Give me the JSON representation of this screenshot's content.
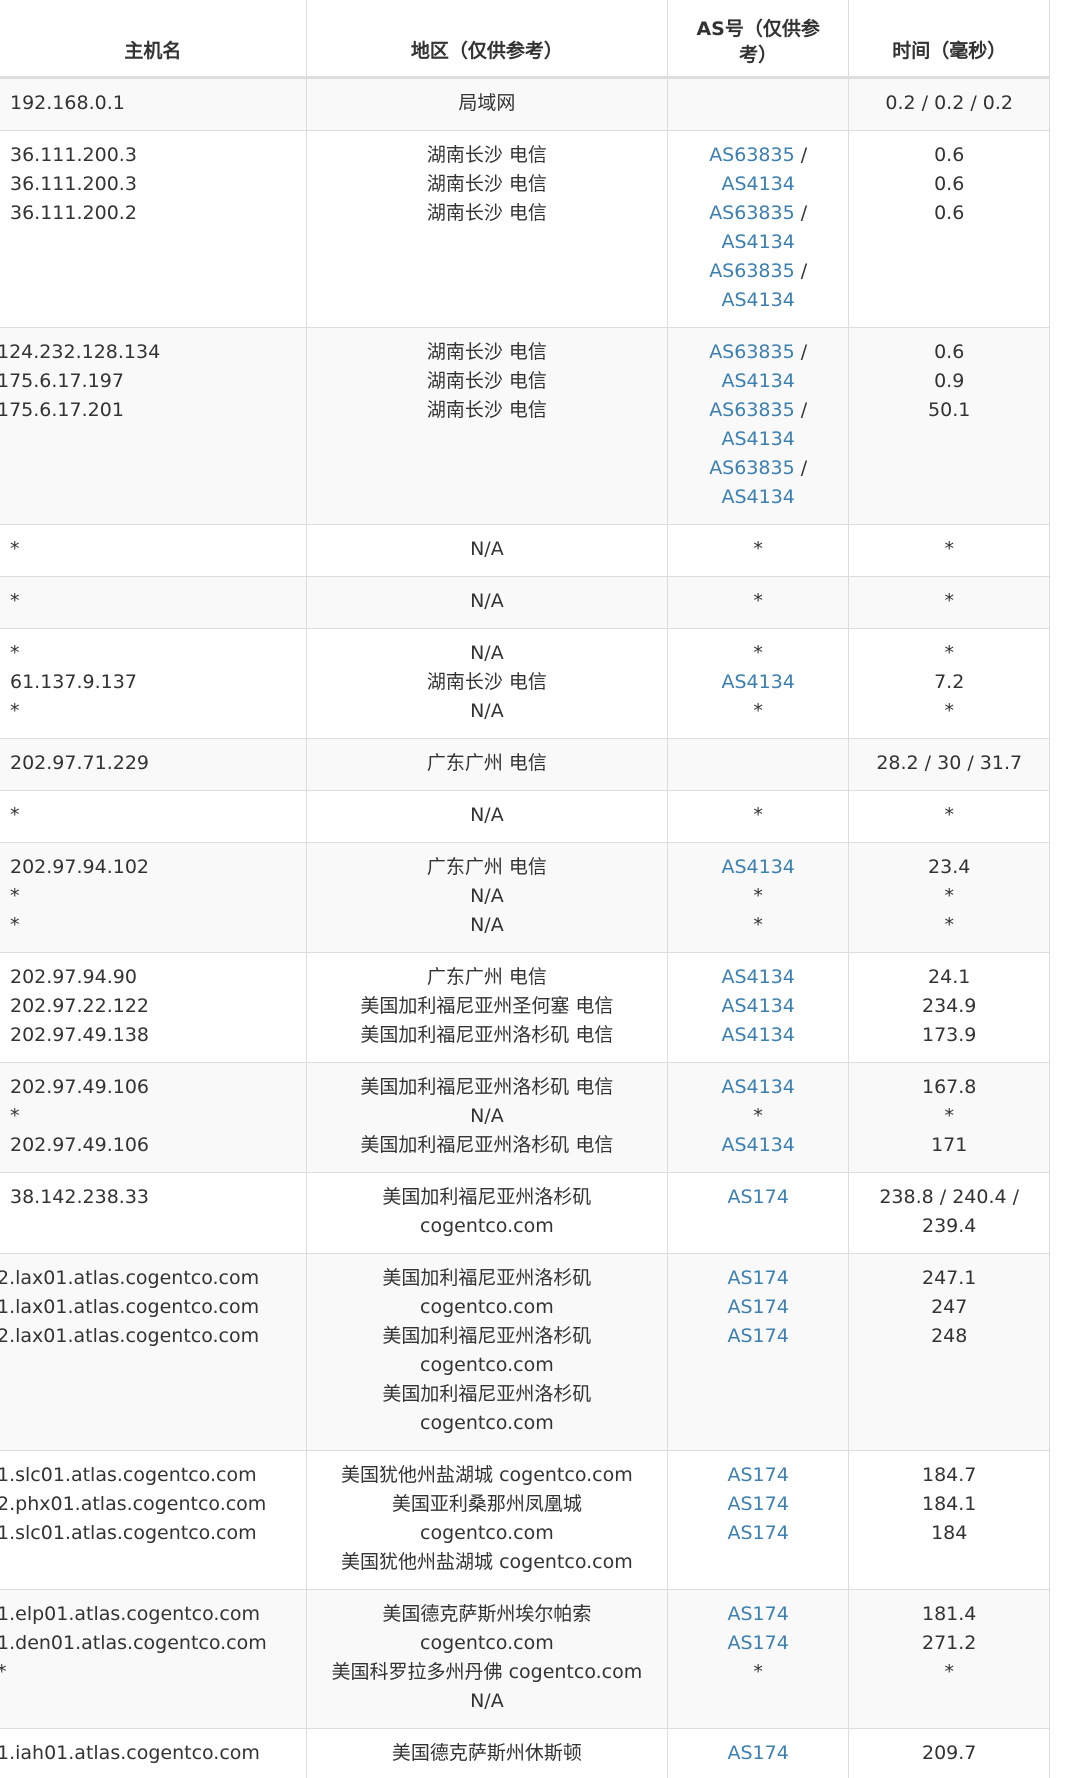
{
  "headers": {
    "host": "主机名",
    "location": "地区（仅供参考）",
    "as_line1": "AS号（仅供参",
    "as_line2": "考）",
    "time": "时间（毫秒）"
  },
  "rows": [
    {
      "hosts": [
        "192.168.0.1"
      ],
      "locations": [
        "局域网"
      ],
      "as": [],
      "times": [
        "0.2 / 0.2 / 0.2"
      ]
    },
    {
      "hosts": [
        "36.111.200.3",
        "36.111.200.3",
        "36.111.200.2"
      ],
      "locations": [
        "湖南长沙 电信",
        "湖南长沙 电信",
        "湖南长沙 电信"
      ],
      "as": [
        [
          "AS63835",
          "AS4134"
        ],
        [
          "AS63835",
          "AS4134"
        ],
        [
          "AS63835",
          "AS4134"
        ]
      ],
      "times": [
        "0.6",
        "0.6",
        "0.6"
      ]
    },
    {
      "hosts": [
        "124.232.128.134",
        "175.6.17.197",
        "175.6.17.201"
      ],
      "locations": [
        "湖南长沙 电信",
        "湖南长沙 电信",
        "湖南长沙 电信"
      ],
      "as": [
        [
          "AS63835",
          "AS4134"
        ],
        [
          "AS63835",
          "AS4134"
        ],
        [
          "AS63835",
          "AS4134"
        ]
      ],
      "times": [
        "0.6",
        "0.9",
        "50.1"
      ]
    },
    {
      "hosts": [
        "*"
      ],
      "locations": [
        "N/A"
      ],
      "as": [
        [
          "*"
        ]
      ],
      "times": [
        "*"
      ]
    },
    {
      "hosts": [
        "*"
      ],
      "locations": [
        "N/A"
      ],
      "as": [
        [
          "*"
        ]
      ],
      "times": [
        "*"
      ]
    },
    {
      "hosts": [
        "*",
        "61.137.9.137",
        "*"
      ],
      "locations": [
        "N/A",
        "湖南长沙 电信",
        "N/A"
      ],
      "as": [
        [
          "*"
        ],
        [
          "AS4134"
        ],
        [
          "*"
        ]
      ],
      "times": [
        "*",
        "7.2",
        "*"
      ]
    },
    {
      "hosts": [
        "202.97.71.229"
      ],
      "locations": [
        "广东广州 电信"
      ],
      "as": [],
      "times": [
        "28.2 / 30 / 31.7"
      ]
    },
    {
      "hosts": [
        "*"
      ],
      "locations": [
        "N/A"
      ],
      "as": [
        [
          "*"
        ]
      ],
      "times": [
        "*"
      ]
    },
    {
      "hosts": [
        "202.97.94.102",
        "*",
        "*"
      ],
      "locations": [
        "广东广州 电信",
        "N/A",
        "N/A"
      ],
      "as": [
        [
          "AS4134"
        ],
        [
          "*"
        ],
        [
          "*"
        ]
      ],
      "times": [
        "23.4",
        "*",
        "*"
      ]
    },
    {
      "hosts": [
        "202.97.94.90",
        "202.97.22.122",
        "202.97.49.138"
      ],
      "locations": [
        "广东广州 电信",
        "美国加利福尼亚州圣何塞 电信",
        "美国加利福尼亚州洛杉矶 电信"
      ],
      "as": [
        [
          "AS4134"
        ],
        [
          "AS4134"
        ],
        [
          "AS4134"
        ]
      ],
      "times": [
        "24.1",
        "234.9",
        "173.9"
      ]
    },
    {
      "hosts": [
        "202.97.49.106",
        "*",
        "202.97.49.106"
      ],
      "locations": [
        "美国加利福尼亚州洛杉矶 电信",
        "N/A",
        "美国加利福尼亚州洛杉矶 电信"
      ],
      "as": [
        [
          "AS4134"
        ],
        [
          "*"
        ],
        [
          "AS4134"
        ]
      ],
      "times": [
        "167.8",
        "*",
        "171"
      ]
    },
    {
      "hosts": [
        "38.142.238.33"
      ],
      "locations": [
        "美国加利福尼亚州洛杉矶",
        "cogentco.com"
      ],
      "as": [
        [
          "AS174"
        ]
      ],
      "times": [
        "238.8 / 240.4 /",
        "239.4"
      ]
    },
    {
      "hosts": [
        "2.lax01.atlas.cogentco.com",
        "1.lax01.atlas.cogentco.com",
        "2.lax01.atlas.cogentco.com"
      ],
      "locations": [
        "美国加利福尼亚州洛杉矶",
        "cogentco.com",
        "美国加利福尼亚州洛杉矶",
        "cogentco.com",
        "美国加利福尼亚州洛杉矶",
        "cogentco.com"
      ],
      "as": [
        [
          "AS174"
        ],
        [
          "AS174"
        ],
        [
          "AS174"
        ]
      ],
      "times": [
        "247.1",
        "247",
        "248"
      ]
    },
    {
      "hosts": [
        "1.slc01.atlas.cogentco.com",
        "2.phx01.atlas.cogentco.com",
        "1.slc01.atlas.cogentco.com"
      ],
      "locations": [
        "美国犹他州盐湖城 cogentco.com",
        "美国亚利桑那州凤凰城",
        "cogentco.com",
        "美国犹他州盐湖城 cogentco.com"
      ],
      "as": [
        [
          "AS174"
        ],
        [
          "AS174"
        ],
        [
          "AS174"
        ]
      ],
      "times": [
        "184.7",
        "184.1",
        "184"
      ]
    },
    {
      "hosts": [
        "1.elp01.atlas.cogentco.com",
        "1.den01.atlas.cogentco.com",
        "*"
      ],
      "locations": [
        "美国德克萨斯州埃尔帕索",
        "cogentco.com",
        "美国科罗拉多州丹佛 cogentco.com",
        "N/A"
      ],
      "as": [
        [
          "AS174"
        ],
        [
          "AS174"
        ],
        [
          "*"
        ]
      ],
      "times": [
        "181.4",
        "271.2",
        "*"
      ]
    },
    {
      "hosts": [
        "1.iah01.atlas.cogentco.com"
      ],
      "locations": [
        "美国德克萨斯州休斯顿"
      ],
      "as": [
        [
          "AS174"
        ]
      ],
      "times": [
        "209.7"
      ]
    }
  ]
}
